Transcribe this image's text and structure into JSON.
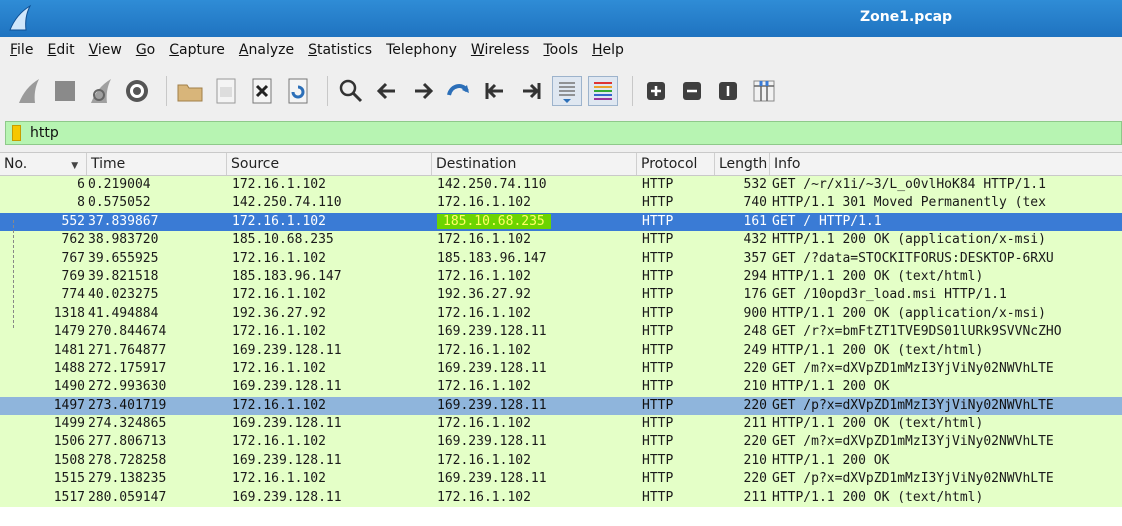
{
  "window": {
    "title": "Zone1.pcap"
  },
  "menu": [
    {
      "label": "File",
      "mnemonic": "F",
      "rest": "ile"
    },
    {
      "label": "Edit",
      "mnemonic": "E",
      "rest": "dit"
    },
    {
      "label": "View",
      "mnemonic": "V",
      "rest": "iew"
    },
    {
      "label": "Go",
      "mnemonic": "G",
      "rest": "o"
    },
    {
      "label": "Capture",
      "mnemonic": "C",
      "rest": "apture"
    },
    {
      "label": "Analyze",
      "mnemonic": "A",
      "rest": "nalyze"
    },
    {
      "label": "Statistics",
      "mnemonic": "S",
      "rest": "tatistics"
    },
    {
      "label": "Telephony",
      "mnemonic": "",
      "rest": "Telephony"
    },
    {
      "label": "Wireless",
      "mnemonic": "W",
      "rest": "ireless"
    },
    {
      "label": "Tools",
      "mnemonic": "T",
      "rest": "ools"
    },
    {
      "label": "Help",
      "mnemonic": "H",
      "rest": "elp"
    }
  ],
  "filter": {
    "value": "http"
  },
  "columns": {
    "no": "No.",
    "time": "Time",
    "source": "Source",
    "destination": "Destination",
    "protocol": "Protocol",
    "length": "Length",
    "info": "Info",
    "sort_indicator": "▼"
  },
  "packets": [
    {
      "no": "6",
      "time": "0.219004",
      "src": "172.16.1.102",
      "dst": "142.250.74.110",
      "proto": "HTTP",
      "len": "532",
      "info": "GET /~r/x1i/~3/L_o0vlHoK84 HTTP/1.1",
      "state": "normal"
    },
    {
      "no": "8",
      "time": "0.575052",
      "src": "142.250.74.110",
      "dst": "172.16.1.102",
      "proto": "HTTP",
      "len": "740",
      "info": "HTTP/1.1 301 Moved Permanently  (tex",
      "state": "normal"
    },
    {
      "no": "552",
      "time": "37.839867",
      "src": "172.16.1.102",
      "dst": "185.10.68.235",
      "proto": "HTTP",
      "len": "161",
      "info": "GET / HTTP/1.1",
      "state": "selected"
    },
    {
      "no": "762",
      "time": "38.983720",
      "src": "185.10.68.235",
      "dst": "172.16.1.102",
      "proto": "HTTP",
      "len": "432",
      "info": "HTTP/1.1 200 OK  (application/x-msi)",
      "state": "normal"
    },
    {
      "no": "767",
      "time": "39.655925",
      "src": "172.16.1.102",
      "dst": "185.183.96.147",
      "proto": "HTTP",
      "len": "357",
      "info": "GET /?data=STOCKITFORUS:DESKTOP-6RXU",
      "state": "normal"
    },
    {
      "no": "769",
      "time": "39.821518",
      "src": "185.183.96.147",
      "dst": "172.16.1.102",
      "proto": "HTTP",
      "len": "294",
      "info": "HTTP/1.1 200 OK  (text/html)",
      "state": "normal"
    },
    {
      "no": "774",
      "time": "40.023275",
      "src": "172.16.1.102",
      "dst": "192.36.27.92",
      "proto": "HTTP",
      "len": "176",
      "info": "GET /10opd3r_load.msi HTTP/1.1",
      "state": "normal"
    },
    {
      "no": "1318",
      "time": "41.494884",
      "src": "192.36.27.92",
      "dst": "172.16.1.102",
      "proto": "HTTP",
      "len": "900",
      "info": "HTTP/1.1 200 OK  (application/x-msi)",
      "state": "normal"
    },
    {
      "no": "1479",
      "time": "270.844674",
      "src": "172.16.1.102",
      "dst": "169.239.128.11",
      "proto": "HTTP",
      "len": "248",
      "info": "GET /r?x=bmFtZT1TVE9DS01lURk9SVVNcZHO",
      "state": "normal"
    },
    {
      "no": "1481",
      "time": "271.764877",
      "src": "169.239.128.11",
      "dst": "172.16.1.102",
      "proto": "HTTP",
      "len": "249",
      "info": "HTTP/1.1 200 OK  (text/html)",
      "state": "normal"
    },
    {
      "no": "1488",
      "time": "272.175917",
      "src": "172.16.1.102",
      "dst": "169.239.128.11",
      "proto": "HTTP",
      "len": "220",
      "info": "GET /m?x=dXVpZD1mMzI3YjViNy02NWVhLTE",
      "state": "normal"
    },
    {
      "no": "1490",
      "time": "272.993630",
      "src": "169.239.128.11",
      "dst": "172.16.1.102",
      "proto": "HTTP",
      "len": "210",
      "info": "HTTP/1.1 200 OK",
      "state": "normal"
    },
    {
      "no": "1497",
      "time": "273.401719",
      "src": "172.16.1.102",
      "dst": "169.239.128.11",
      "proto": "HTTP",
      "len": "220",
      "info": "GET /p?x=dXVpZD1mMzI3YjViNy02NWVhLTE",
      "state": "related"
    },
    {
      "no": "1499",
      "time": "274.324865",
      "src": "169.239.128.11",
      "dst": "172.16.1.102",
      "proto": "HTTP",
      "len": "211",
      "info": "HTTP/1.1 200 OK  (text/html)",
      "state": "normal"
    },
    {
      "no": "1506",
      "time": "277.806713",
      "src": "172.16.1.102",
      "dst": "169.239.128.11",
      "proto": "HTTP",
      "len": "220",
      "info": "GET /m?x=dXVpZD1mMzI3YjViNy02NWVhLTE",
      "state": "normal"
    },
    {
      "no": "1508",
      "time": "278.728258",
      "src": "169.239.128.11",
      "dst": "172.16.1.102",
      "proto": "HTTP",
      "len": "210",
      "info": "HTTP/1.1 200 OK",
      "state": "normal"
    },
    {
      "no": "1515",
      "time": "279.138235",
      "src": "172.16.1.102",
      "dst": "169.239.128.11",
      "proto": "HTTP",
      "len": "220",
      "info": "GET /p?x=dXVpZD1mMzI3YjViNy02NWVhLTE",
      "state": "normal"
    },
    {
      "no": "1517",
      "time": "280.059147",
      "src": "169.239.128.11",
      "dst": "172.16.1.102",
      "proto": "HTTP",
      "len": "211",
      "info": "HTTP/1.1 200 OK  (text/html)",
      "state": "normal"
    }
  ],
  "colors": {
    "titlebar": "#1f73c0",
    "row_http": "#e4ffc7",
    "row_selected": "#3a7bd5",
    "row_related": "#8fb5dc",
    "filter_valid": "#b7f4b2",
    "dest_highlight": "#6cd400"
  },
  "toolbar_icons": [
    "start-capture-icon",
    "stop-capture-icon",
    "restart-capture-icon",
    "capture-options-icon",
    "open-file-icon",
    "save-file-icon",
    "close-file-icon",
    "reload-file-icon",
    "find-packet-icon",
    "go-back-icon",
    "go-forward-icon",
    "go-to-packet-icon",
    "first-packet-icon",
    "last-packet-icon",
    "autoscroll-icon",
    "colorize-icon",
    "zoom-in-icon",
    "zoom-out-icon",
    "normal-size-icon",
    "resize-columns-icon"
  ]
}
